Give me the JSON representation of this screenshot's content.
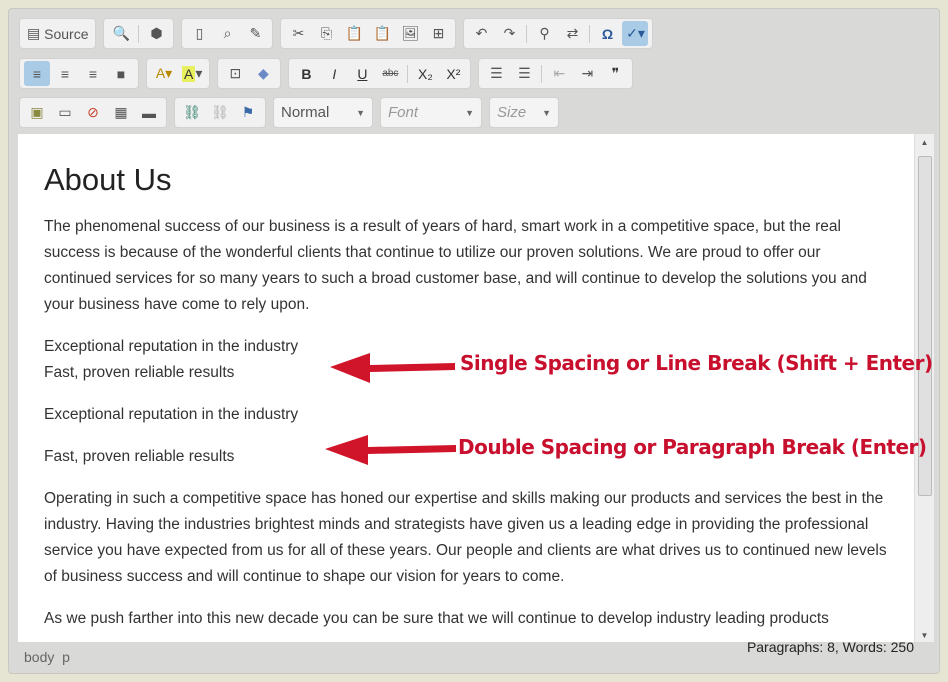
{
  "toolbar": {
    "source_label": "Source",
    "row1_icons": [
      [
        "preview-icon",
        "templates-icon"
      ],
      [
        "paste-icon",
        "find-page-icon",
        "spell-icon"
      ],
      [
        "cut-icon",
        "copy-icon",
        "paste-text-icon",
        "paste-word-icon",
        "paste-image-icon",
        "html-icon"
      ]
    ],
    "row1_last": [
      "undo-icon",
      "redo-icon",
      "find-icon",
      "replace-icon",
      "special-char-icon",
      "spellcheck-icon"
    ],
    "format_value": "Normal",
    "font_placeholder": "Font",
    "size_placeholder": "Size",
    "glyphs": {
      "bold": "B",
      "italic": "I",
      "underline": "U",
      "strike": "abc",
      "sub": "X₂",
      "sup": "X²",
      "quote": "❞",
      "omega": "Ω",
      "undo": "↶",
      "redo": "↷"
    }
  },
  "content": {
    "title": "About Us",
    "p1": "The phenomenal success of our business is a result of years of hard, smart work in a competitive space, but the real success is because of the wonderful clients that continue to utilize our proven solutions. We are proud to offer our continued services for so many years to such a broad customer base, and will continue to develop the solutions you and your business have come to rely upon.",
    "line1": "Exceptional reputation in the industry",
    "line2": "Fast, proven reliable results",
    "line3": "Exceptional reputation in the industry",
    "line4": "Fast, proven reliable results",
    "p2": "Operating in such a competitive space has honed our expertise and skills making our products and services the best in the industry. Having the industries brightest minds and strategists have given us a leading edge in providing the professional service you have expected from us for all of these years. Our people and clients are what drives us to continued new levels of business success and will continue to shape our vision for years to come.",
    "p3": "As we push farther into this new decade you can be sure that we will continue to develop industry leading products"
  },
  "annotations": {
    "single": "Single Spacing or Line Break (Shift + Enter)",
    "double": "Double Spacing or Paragraph Break (Enter)",
    "color": "#c8102e"
  },
  "status": {
    "path_body": "body",
    "path_p": "p",
    "counts": "Paragraphs: 8, Words: 250"
  }
}
